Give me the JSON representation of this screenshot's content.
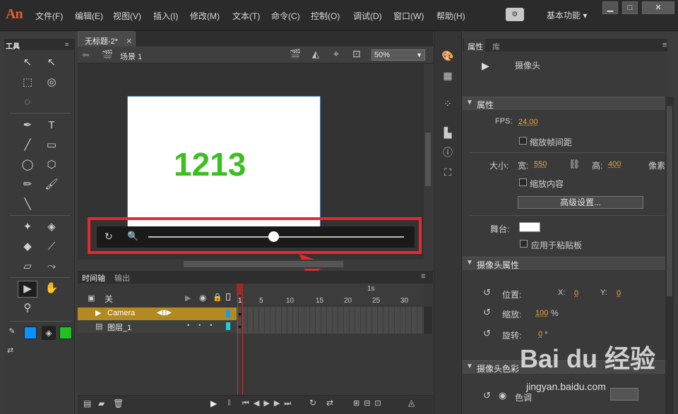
{
  "app": {
    "logo": "An"
  },
  "menu": [
    "文件(F)",
    "编辑(E)",
    "视图(V)",
    "插入(I)",
    "修改(M)",
    "文本(T)",
    "命令(C)",
    "控制(O)",
    "调试(D)",
    "窗口(W)",
    "帮助(H)"
  ],
  "workspace": "基本功能 ▾",
  "tools_tab": "工具",
  "document": {
    "tab": "无标题-2*",
    "close": "✕",
    "scene": "场景 1",
    "zoom": "50%"
  },
  "stage": {
    "text": "1213",
    "text_color": "#3cc01f"
  },
  "camera_slider": {
    "value_fraction": 0.49
  },
  "timeline": {
    "tabs": [
      "时间轴",
      "输出"
    ],
    "header_label": "关",
    "ruler_seconds": "1s",
    "ruler_frames": [
      "1",
      "5",
      "10",
      "15",
      "20",
      "25",
      "30"
    ],
    "layers": [
      {
        "name": "Camera"
      },
      {
        "name": "图层_1"
      }
    ]
  },
  "properties": {
    "tabs": [
      "属性",
      "库"
    ],
    "object_name": "摄像头",
    "sections": {
      "props": "属性",
      "camera_props": "摄像头属性",
      "camera_color": "摄像头色彩"
    },
    "fps_label": "FPS:",
    "fps": "24.00",
    "scale_spacing": "缩放帧间距",
    "size_label": "大小:",
    "width_label": "宽:",
    "width": "550",
    "height_label": "高:",
    "height": "400",
    "unit": "像素",
    "scale_content": "缩放内容",
    "advanced": "高级设置...",
    "stage_label": "舞台:",
    "apply_paste": "应用于粘贴板",
    "position_label": "位置:",
    "x_label": "X:",
    "x_val": "0",
    "y_label": "Y:",
    "y_val": "0",
    "zoom_label": "缩放:",
    "zoom_val": "100",
    "zoom_unit": "%",
    "rotate_label": "旋转:",
    "rotate_val": "0",
    "rotate_unit": "°",
    "color_label": "色调"
  },
  "watermark": {
    "logo": "Bai du 经验",
    "url": "jingyan.baidu.com"
  }
}
